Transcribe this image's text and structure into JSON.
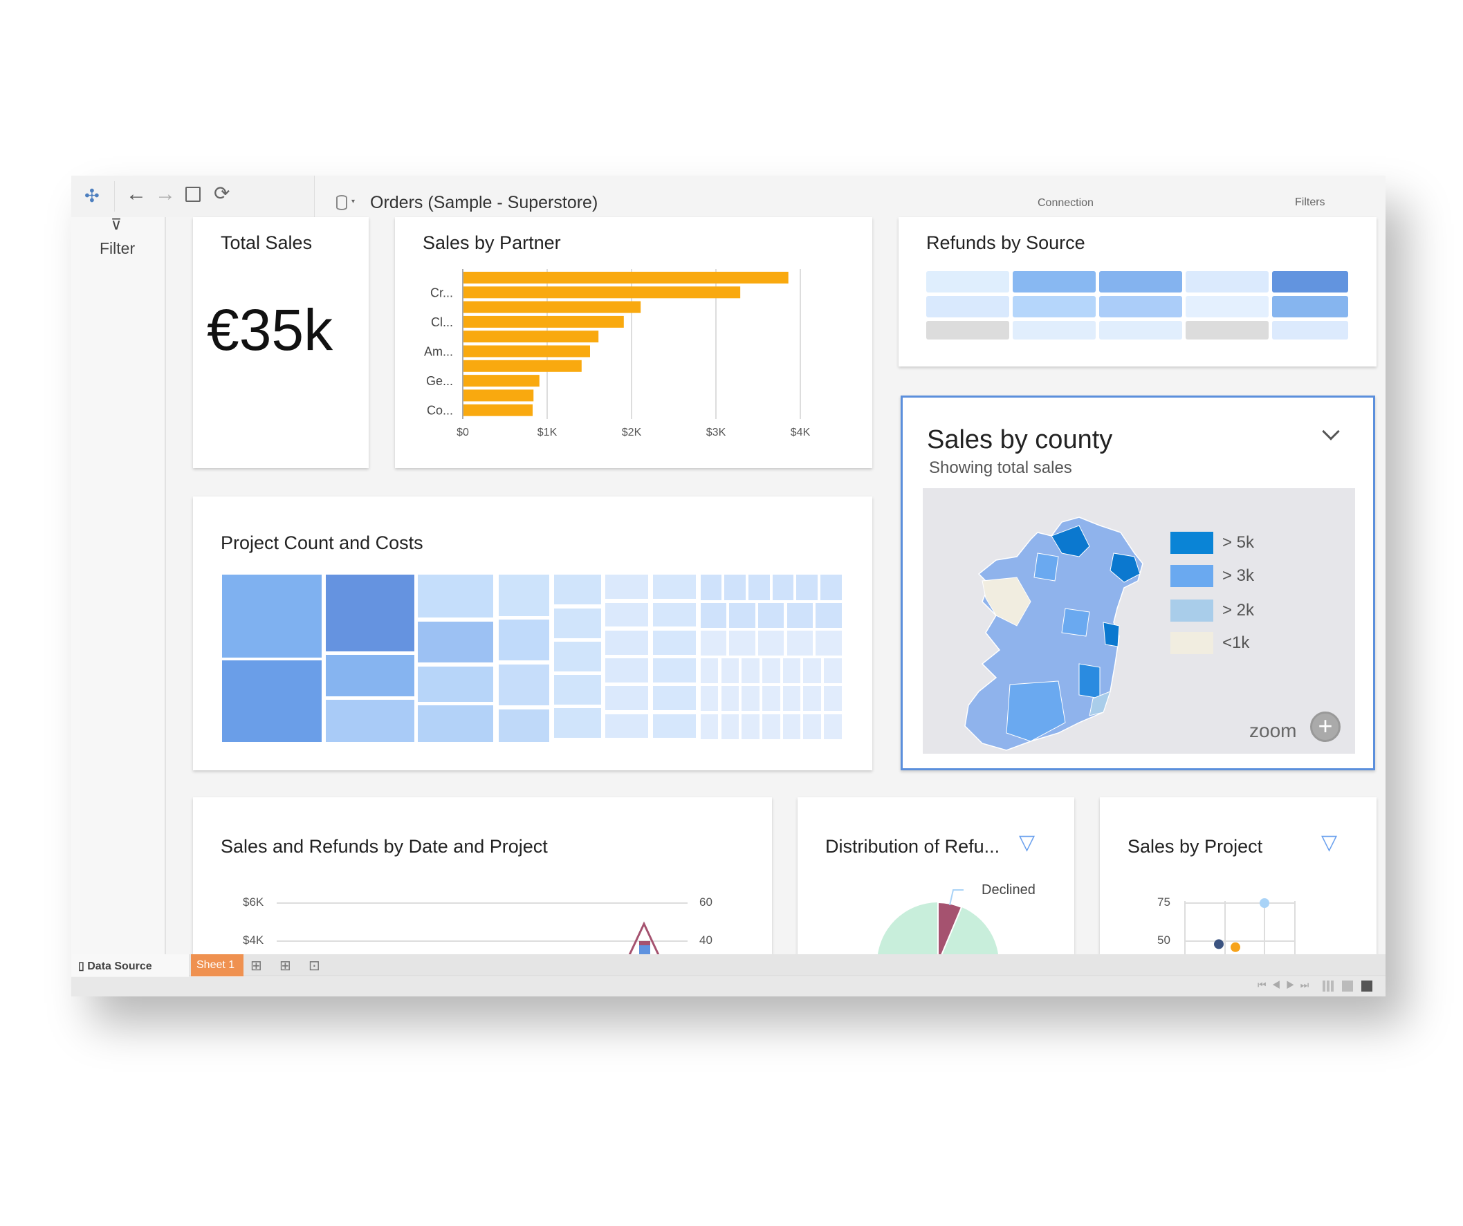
{
  "toolbar": {
    "icons": [
      "tableau-logo-icon",
      "back-arrow-icon",
      "forward-arrow-icon",
      "save-icon",
      "refresh-icon"
    ],
    "datasource_title": "Orders (Sample - Superstore)",
    "connection_label": "Connection",
    "filters_label": "Filters"
  },
  "sidebar": {
    "filter_label": "Filter"
  },
  "total_sales": {
    "title": "Total Sales",
    "value": "€35k"
  },
  "sales_by_partner": {
    "title": "Sales by Partner"
  },
  "refunds_by_source": {
    "title": "Refunds by Source",
    "colors": [
      [
        "#dfeefd",
        "#88b8f2",
        "#84b3ef",
        "#dbeafd",
        "#6294df"
      ],
      [
        "#d9e9fd",
        "#b5d6fb",
        "#abcdf9",
        "#e4f0fe",
        "#86b5ef"
      ],
      [
        "#dcdcdc",
        "#e1eefd",
        "#e1eefd",
        "#dcdcdc",
        "#dceafd"
      ]
    ]
  },
  "sales_by_county": {
    "title": "Sales by county",
    "subtitle": "Showing total sales",
    "zoom_label": "zoom",
    "legend": [
      {
        "label": "> 5k",
        "color": "#0a84d6"
      },
      {
        "label": "> 3k",
        "color": "#6aa9f0"
      },
      {
        "label": "> 2k",
        "color": "#a9cdea"
      },
      {
        "label": "<1k",
        "color": "#f1ede0"
      }
    ]
  },
  "project_count": {
    "title": "Project Count and Costs"
  },
  "sales_refunds_date": {
    "title": "Sales and Refunds by Date and Project",
    "left_ticks": [
      "$6K",
      "$4K"
    ],
    "right_ticks": [
      "60",
      "40"
    ]
  },
  "distribution": {
    "title": "Distribution of Refu...",
    "slice_label": "Declined",
    "colors": {
      "declined": "#a5526f",
      "other": "#c8eedb"
    }
  },
  "sales_by_project": {
    "title": "Sales by Project",
    "ticks": [
      "75",
      "50"
    ]
  },
  "tabs": {
    "data_source": "Data Source",
    "sheet1": "Sheet 1"
  },
  "accent": "#ef9150",
  "chart_data": [
    {
      "type": "bar",
      "title": "Sales by Partner",
      "orientation": "horizontal",
      "categories": [
        "",
        "Cr...",
        "",
        "Cl...",
        "",
        "Am...",
        "",
        "Ge...",
        "",
        "Co..."
      ],
      "values": [
        3850,
        3280,
        2100,
        1900,
        1600,
        1500,
        1400,
        900,
        830,
        820
      ],
      "xticks": [
        "$0",
        "$1K",
        "$2K",
        "$3K",
        "$4K"
      ],
      "xlim": [
        0,
        4000
      ],
      "color": "#f9a90f"
    },
    {
      "type": "scatter",
      "title": "Sales by Project",
      "yticks": [
        75,
        50
      ],
      "points": [
        {
          "y": 48,
          "color": "#3b5380"
        },
        {
          "y": 46,
          "color": "#f6a31b"
        },
        {
          "y": 75,
          "color": "#a9d3f7"
        }
      ]
    }
  ]
}
